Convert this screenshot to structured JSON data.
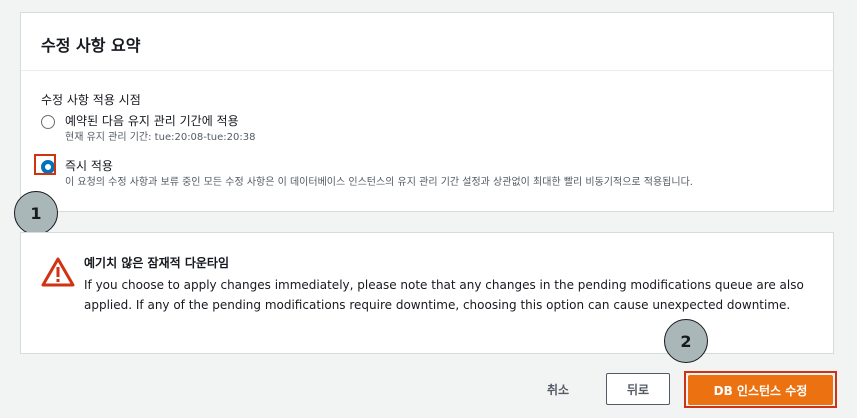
{
  "summary_panel": {
    "title": "수정 사항 요약",
    "timing_label": "수정 사항 적용 시점",
    "options": [
      {
        "title": "예약된 다음 유지 관리 기간에 적용",
        "description": "현재 유지 관리 기간: tue:20:08-tue:20:38",
        "selected": false
      },
      {
        "title": "즉시 적용",
        "description": "이 요청의 수정 사항과 보류 중인 모든 수정 사항은 이 데이터베이스 인스턴스의 유지 관리 기간 설정과 상관없이 최대한 빨리 비동기적으로 적용됩니다.",
        "selected": true
      }
    ]
  },
  "callouts": [
    "1",
    "2"
  ],
  "alert": {
    "icon": "warning-triangle-icon",
    "title": "예기치 않은 잠재적 다운타임",
    "body": "If you choose to apply changes immediately, please note that any changes in the pending modifications queue are also applied. If any of the pending modifications require downtime, choosing this option can cause unexpected downtime."
  },
  "footer": {
    "cancel_label": "취소",
    "back_label": "뒤로",
    "submit_label": "DB 인스턴스 수정"
  },
  "colors": {
    "primary": "#ec7211",
    "selected_radio": "#0073bb",
    "highlight": "#d13212",
    "warning": "#d13212"
  }
}
